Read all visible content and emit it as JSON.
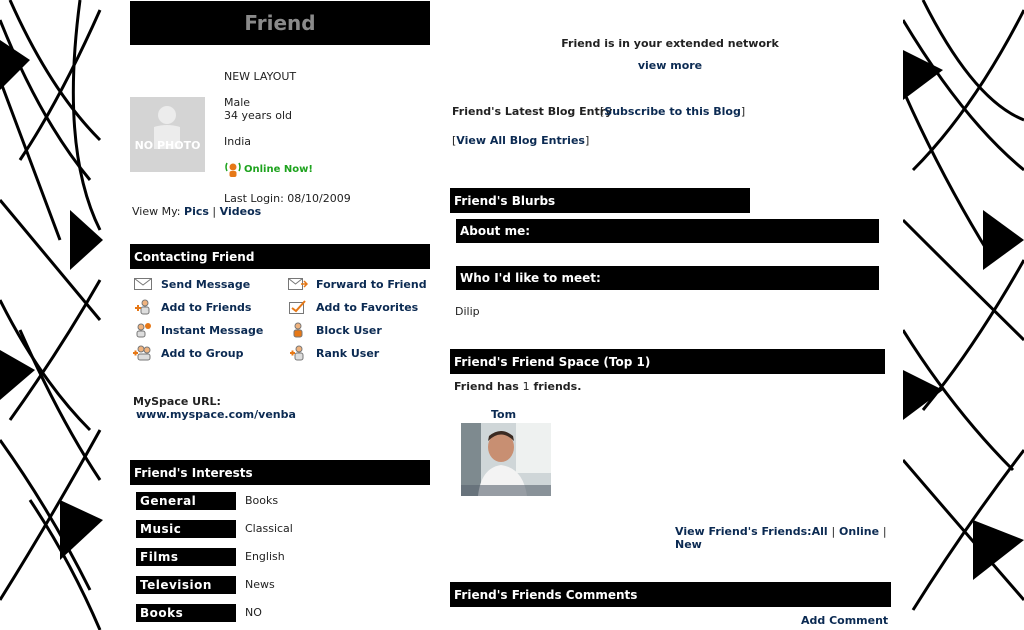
{
  "profile": {
    "name": "Friend",
    "headline": "NEW LAYOUT",
    "gender": "Male",
    "age": "34 years old",
    "location": "India",
    "online_status": "Online Now!",
    "last_login": "Last Login: 08/10/2009",
    "view_my_label": "View My:",
    "pics_link": "Pics",
    "separator": "|",
    "videos_link": "Videos",
    "photo_placeholder": "NO PHOTO"
  },
  "contacting": {
    "title": "Contacting Friend",
    "actions_left": [
      {
        "label": "Send Message",
        "icon": "mail-icon"
      },
      {
        "label": "Add to Friends",
        "icon": "add-friend-icon"
      },
      {
        "label": "Instant Message",
        "icon": "instant-message-icon"
      },
      {
        "label": "Add to Group",
        "icon": "group-icon"
      }
    ],
    "actions_right": [
      {
        "label": "Forward to Friend",
        "icon": "forward-mail-icon"
      },
      {
        "label": "Add to Favorites",
        "icon": "favorites-icon"
      },
      {
        "label": "Block User",
        "icon": "block-user-icon"
      },
      {
        "label": "Rank User",
        "icon": "rank-user-icon"
      }
    ]
  },
  "myspace_url": {
    "label": "MySpace URL:",
    "value": "www.myspace.com/venba"
  },
  "interests": {
    "title": "Friend's Interests",
    "rows": [
      {
        "label": "General",
        "value": "Books"
      },
      {
        "label": "Music",
        "value": "Classical"
      },
      {
        "label": "Films",
        "value": "English"
      },
      {
        "label": "Television",
        "value": "News"
      },
      {
        "label": "Books",
        "value": "NO"
      }
    ]
  },
  "network": {
    "text": "Friend is in your extended network",
    "view_more": "view more"
  },
  "blog": {
    "latest_label": "Friend's Latest Blog Entry",
    "subscribe": "Subscribe to this Blog",
    "view_all": "View All Blog Entries"
  },
  "blurbs": {
    "title": "Friend's Blurbs",
    "about_me": "About me:",
    "like_to_meet": "Who I'd like to meet:",
    "meet_text": "Dilip"
  },
  "friend_space": {
    "title": "Friend's Friend Space (Top 1)",
    "count_prefix": "Friend has",
    "count": "1",
    "count_suffix": "friends.",
    "friend_name": "Tom",
    "view_label": "View Friend's Friends:",
    "all": "All",
    "online": "Online",
    "new": "New"
  },
  "comments": {
    "title": "Friend's Friends Comments",
    "add": "Add Comment"
  },
  "colors": {
    "bar": "#000000",
    "link": "#0b2a52",
    "online": "#1ea31e"
  }
}
